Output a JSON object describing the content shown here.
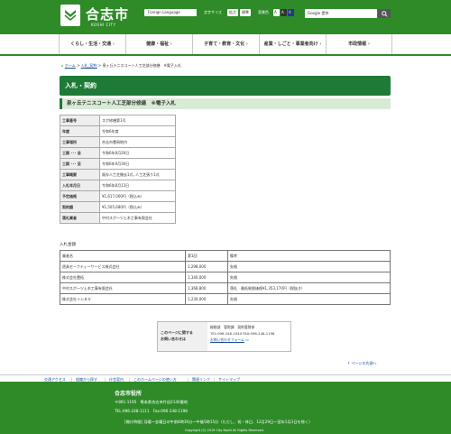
{
  "header": {
    "city_name": "合志市",
    "city_sub": "KOSHI CITY",
    "foreign_language": "Foreign Language",
    "text_size_label": "文字サイズ",
    "text_size_enlarge": "拡大",
    "text_size_standard": "標準",
    "bg_color_label": "背景色",
    "color_chip_1": "A",
    "color_chip_2": "A",
    "color_chip_3": "A",
    "search_placeholder": "Google 提供",
    "search_button_icon": "magnifier-icon"
  },
  "nav": {
    "items": [
      {
        "label": "くらし・生活・交通"
      },
      {
        "label": "健康・福祉"
      },
      {
        "label": "子育て・教育・文化"
      },
      {
        "label": "産業・しごと・事業者向け"
      },
      {
        "label": "市政情報"
      }
    ]
  },
  "breadcrumb": {
    "home": "ホーム",
    "sep1": ">",
    "item1": "入札_契約",
    "sep2": ">",
    "current": "泉ヶ丘テニスコート人工芝部分修繕　※電子入札"
  },
  "main": {
    "page_title": "入札・契約",
    "sub_title": "泉ヶ丘テニスコート人工芝部分修繕　※電子入札",
    "info_rows": [
      {
        "key": "工事番号",
        "value": "スポ修繕第1号"
      },
      {
        "key": "年度",
        "value": "令和6年度"
      },
      {
        "key": "工事場所",
        "value": "合志市豊岡地内"
      },
      {
        "key": "工期 ･･･ 自",
        "value": "令和6年8月26日"
      },
      {
        "key": "工期 ･･･ 至",
        "value": "令和6年9月30日"
      },
      {
        "key": "工事概要",
        "value": "既存人工芝撤去1式, 人工芝張り1式"
      },
      {
        "key": "入札年月日",
        "value": "令和6年8月13日"
      },
      {
        "key": "予定価格",
        "value": "¥1,617,000円（税込み）"
      },
      {
        "key": "契約額",
        "value": "¥1,505,680円（税込み）"
      },
      {
        "key": "落札業者",
        "value": "中村スポーツ土木工事有限会社"
      }
    ],
    "bid_label": "入札金額",
    "bid_headers": {
      "c1": "業者名",
      "c2": "第1回",
      "c3": "備考"
    },
    "bids": [
      {
        "name": "遊具セーフティーサービス株式会社",
        "amount": "1,298,000",
        "note": "失格"
      },
      {
        "name": "株式会社豊拓",
        "amount": "1,340,000",
        "note": "失格"
      },
      {
        "name": "中村スポーツ土木工事有限会社",
        "amount": "1,368,800",
        "note": "落札　最低制限価格¥1,353,170円（税抜き）"
      },
      {
        "name": "株式会社イシヌキ",
        "amount": "1,230,000",
        "note": "失格"
      }
    ]
  },
  "contact": {
    "heading_1": "このページに関する",
    "heading_2": "お問い合わせは",
    "dept": "総務部　管財課　契約管財係",
    "phone": "TEL:096-248-1040 FAX:096-248-1196",
    "form_link": "お問い合わせフォーム"
  },
  "page_top": "ページの先頭へ",
  "footer_links": [
    {
      "label": "交通アクセス"
    },
    {
      "label": "組織から探す"
    },
    {
      "label": "庁舎案内"
    },
    {
      "label": "このホームページの使い方"
    },
    {
      "label": "関連リンク"
    },
    {
      "label": "サイトマップ"
    }
  ],
  "footer": {
    "name": "合志市役所",
    "address": "〒861-1195　熊本県合志市竹迫2140番地",
    "tel": "TEL:096-248-1111　Fax:096-248-1198",
    "hours": "[開庁時間] 月曜～金曜日の午前8時30分～午後5時15分（ただし、祝・休日、12月29日～翌年1月3日を除く）",
    "copyright": "Copyright (C) 2019 City Koshi All Rights Reserved."
  },
  "colors": {
    "brand_green": "#2e8b28",
    "title_green": "#1e7a37",
    "subtitle_bg": "#d8ebd5",
    "link_blue": "#1a4f9c"
  }
}
